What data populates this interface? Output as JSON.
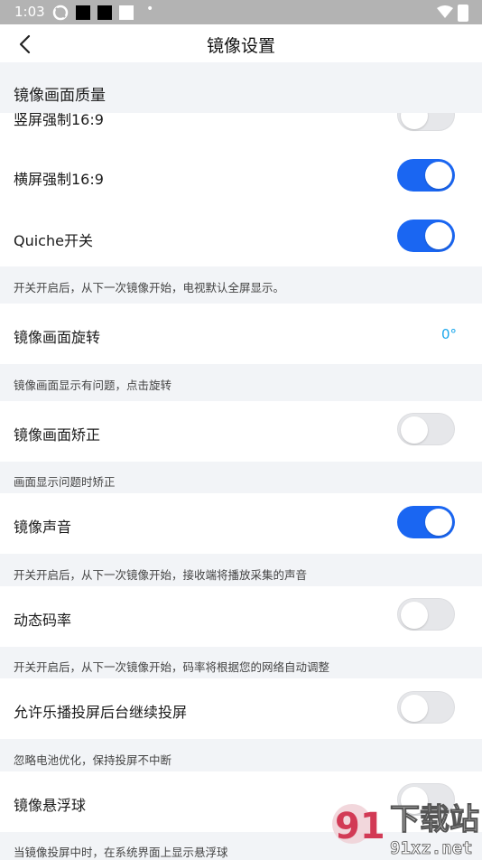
{
  "status_bar": {
    "time": "1:03"
  },
  "header": {
    "title": "镜像设置"
  },
  "section": {
    "title": "镜像画面质量"
  },
  "rows": [
    {
      "label": "竖屏强制16:9",
      "toggle": "off"
    },
    {
      "label": "横屏强制16:9",
      "toggle": "on"
    },
    {
      "label": "Quiche开关",
      "toggle": "on",
      "hint": "开关开启后，从下一次镜像开始，电视默认全屏显示。"
    },
    {
      "label": "镜像画面旋转",
      "value": "0°",
      "hint": "镜像画面显示有问题，点击旋转"
    },
    {
      "label": "镜像画面矫正",
      "toggle": "off",
      "hint": "画面显示问题时矫正"
    },
    {
      "label": "镜像声音",
      "toggle": "on",
      "hint": "开关开启后，从下一次镜像开始，接收端将播放采集的声音"
    },
    {
      "label": "动态码率",
      "toggle": "off",
      "hint": "开关开启后，从下一次镜像开始，码率将根据您的网络自动调整"
    },
    {
      "label": "允许乐播投屏后台继续投屏",
      "toggle": "off",
      "hint": "忽略电池优化，保持投屏不中断"
    },
    {
      "label": "镜像悬浮球",
      "toggle": "off",
      "hint": "当镜像投屏中时，在系统界面上显示悬浮球"
    }
  ],
  "watermark": {
    "text_cn": "下载站",
    "text_url": "91xz.net"
  },
  "colors": {
    "accent": "#1a66f2",
    "value_text": "#1aa7ec",
    "background": "#f2f4f7",
    "toggle_off": "#e6e7ea"
  }
}
